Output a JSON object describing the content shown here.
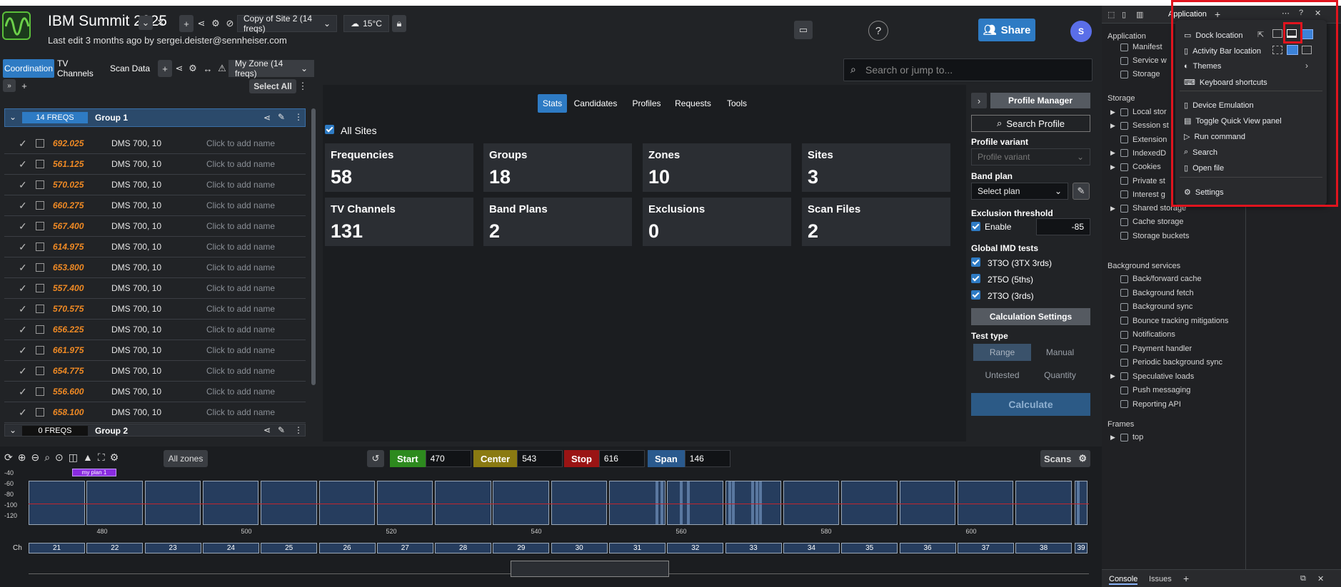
{
  "header": {
    "title": "IBM Summit 2025",
    "subtitle": "Last edit 3 months ago by sergei.deister@sennheiser.com",
    "site_select": "Copy of Site 2 (14 freqs)",
    "weather": "15°C",
    "share_label": "Share",
    "avatar_letter": "S"
  },
  "nav": {
    "tabs": [
      "Coordination",
      "TV Channels",
      "Scan Data"
    ],
    "zone_select": "My Zone (14 freqs)",
    "search_placeholder": "Search or jump to..."
  },
  "left": {
    "select_all": "Select All",
    "group": {
      "badge": "14 FREQS",
      "name": "Group 1"
    },
    "group2": {
      "badge": "0 FREQS",
      "name": "Group 2"
    },
    "rows": [
      {
        "freq": "692.025",
        "model": "DMS 700, 10",
        "name": "Click to add name"
      },
      {
        "freq": "561.125",
        "model": "DMS 700, 10",
        "name": "Click to add name"
      },
      {
        "freq": "570.025",
        "model": "DMS 700, 10",
        "name": "Click to add name"
      },
      {
        "freq": "660.275",
        "model": "DMS 700, 10",
        "name": "Click to add name"
      },
      {
        "freq": "567.400",
        "model": "DMS 700, 10",
        "name": "Click to add name"
      },
      {
        "freq": "614.975",
        "model": "DMS 700, 10",
        "name": "Click to add name"
      },
      {
        "freq": "653.800",
        "model": "DMS 700, 10",
        "name": "Click to add name"
      },
      {
        "freq": "557.400",
        "model": "DMS 700, 10",
        "name": "Click to add name"
      },
      {
        "freq": "570.575",
        "model": "DMS 700, 10",
        "name": "Click to add name"
      },
      {
        "freq": "656.225",
        "model": "DMS 700, 10",
        "name": "Click to add name"
      },
      {
        "freq": "661.975",
        "model": "DMS 700, 10",
        "name": "Click to add name"
      },
      {
        "freq": "654.775",
        "model": "DMS 700, 10",
        "name": "Click to add name"
      },
      {
        "freq": "556.600",
        "model": "DMS 700, 10",
        "name": "Click to add name"
      },
      {
        "freq": "658.100",
        "model": "DMS 700, 10",
        "name": "Click to add name"
      }
    ]
  },
  "center": {
    "tabs": [
      "Stats",
      "Candidates",
      "Profiles",
      "Requests",
      "Tools"
    ],
    "all_sites": "All Sites",
    "stats": [
      {
        "label": "Frequencies",
        "value": "58"
      },
      {
        "label": "Groups",
        "value": "18"
      },
      {
        "label": "Zones",
        "value": "10"
      },
      {
        "label": "Sites",
        "value": "3"
      },
      {
        "label": "TV Channels",
        "value": "131"
      },
      {
        "label": "Band Plans",
        "value": "2"
      },
      {
        "label": "Exclusions",
        "value": "0"
      },
      {
        "label": "Scan Files",
        "value": "2"
      }
    ]
  },
  "right": {
    "profile_manager": "Profile Manager",
    "search_profile": "Search Profile",
    "profile_variant_label": "Profile variant",
    "profile_variant_placeholder": "Profile variant",
    "band_plan_label": "Band plan",
    "band_plan_select": "Select plan",
    "exclusion_label": "Exclusion threshold",
    "enable": "Enable",
    "threshold": "-85",
    "imd_label": "Global IMD tests",
    "imd_tests": [
      "3T3O (3TX 3rds)",
      "2T5O (5ths)",
      "2T3O (3rds)"
    ],
    "calc_settings": "Calculation Settings",
    "test_type_label": "Test type",
    "test_types": [
      "Range",
      "Manual",
      "Untested",
      "Quantity"
    ],
    "calculate": "Calculate"
  },
  "bottom": {
    "all_zones": "All zones",
    "start_label": "Start",
    "start": "470",
    "center_label": "Center",
    "center": "543",
    "stop_label": "Stop",
    "stop": "616",
    "span_label": "Span",
    "span": "146",
    "scans": "Scans",
    "plan_tag": "my plan 1",
    "y_ticks": [
      "-40",
      "-60",
      "-80",
      "-100",
      "-120"
    ],
    "x_ticks": [
      "480",
      "500",
      "520",
      "540",
      "560",
      "580",
      "600"
    ],
    "ch_label": "Ch",
    "channels": [
      "21",
      "22",
      "23",
      "24",
      "25",
      "26",
      "27",
      "28",
      "29",
      "30",
      "31",
      "32",
      "33",
      "34",
      "35",
      "36",
      "37",
      "38",
      "39"
    ]
  },
  "devtools": {
    "tab": "Application",
    "section_app": "Application",
    "app_items": [
      "Manifest",
      "Service w",
      "Storage"
    ],
    "section_storage": "Storage",
    "storage_items": [
      "Local stor",
      "Session st",
      "Extension",
      "IndexedD",
      "Cookies",
      "Private st",
      "Interest g",
      "Shared storage",
      "Cache storage",
      "Storage buckets"
    ],
    "section_bg": "Background services",
    "bg_items": [
      "Back/forward cache",
      "Background fetch",
      "Background sync",
      "Bounce tracking mitigations",
      "Notifications",
      "Payment handler",
      "Periodic background sync",
      "Speculative loads",
      "Push messaging",
      "Reporting API"
    ],
    "section_frames": "Frames",
    "frames_top": "top",
    "bottom_tabs": [
      "Console",
      "Issues"
    ],
    "menu": {
      "dock": "Dock location",
      "activity": "Activity Bar location",
      "themes": "Themes",
      "shortcuts": "Keyboard shortcuts",
      "emulation": "Device Emulation",
      "quickview": "Toggle Quick View panel",
      "run": "Run command",
      "search": "Search",
      "open": "Open file",
      "settings": "Settings"
    }
  }
}
